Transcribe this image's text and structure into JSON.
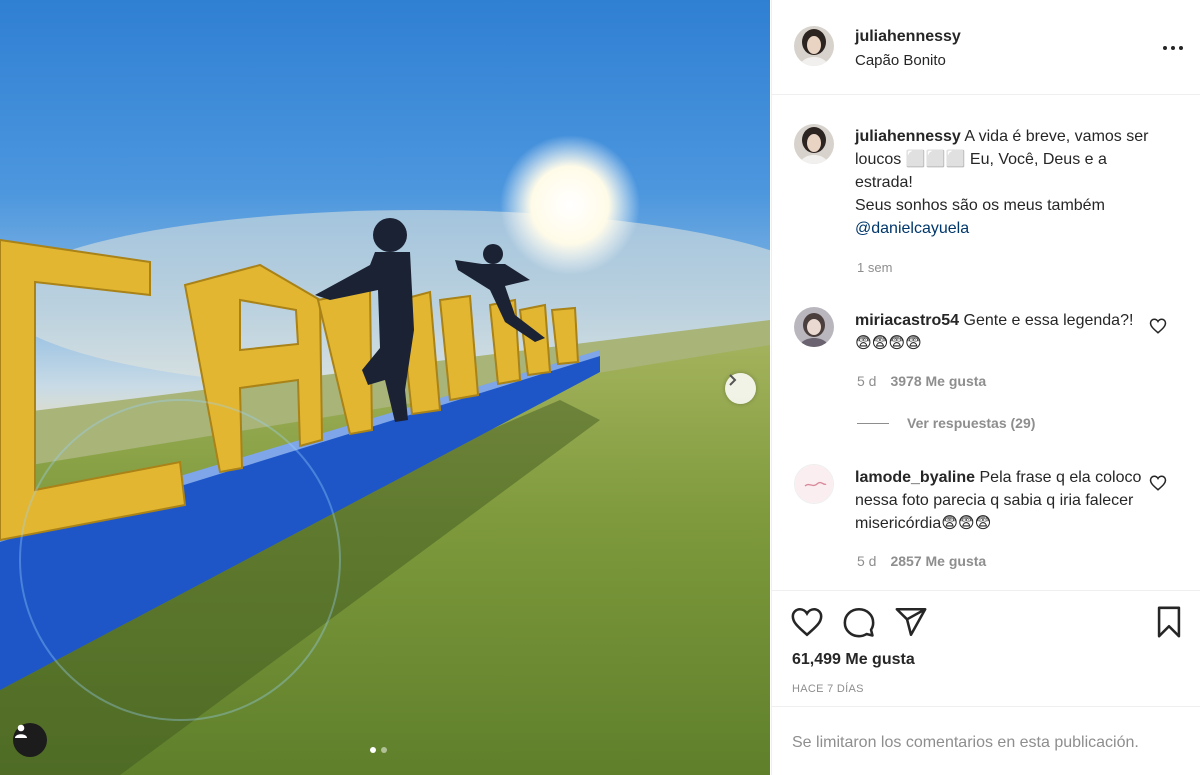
{
  "post": {
    "username": "juliahennessy",
    "location": "Capão Bonito",
    "caption": {
      "username": "juliahennessy",
      "line1": " A vida é breve, vamos ser loucos ⬜⬜⬜ Eu, Você, Deus e a estrada!",
      "line2": "Seus sonhos são os meus também",
      "mention": "@danielcayuela",
      "age": "1 sem"
    },
    "likes": "61,499 Me gusta",
    "posted": "HACE 7 DÍAS",
    "comments_limited": "Se limitaron los comentarios en esta publicación."
  },
  "comments": [
    {
      "username": "miriacastro54",
      "text": " Gente e essa legenda?!😨😨😨😨",
      "age": "5 d",
      "likes": "3978 Me gusta",
      "replies": "Ver respuestas (29)"
    },
    {
      "username": "lamode_byaline",
      "text": " Pela frase q ela coloco nessa foto parecia q sabia q iria falecer misericórdia😨😨😨",
      "age": "5 d",
      "likes": "2857 Me gusta"
    }
  ],
  "icons": {
    "more": "more-options-icon",
    "like": "heart-icon",
    "comment": "comment-icon",
    "share": "share-icon",
    "save": "bookmark-icon",
    "next": "chevron-right-icon",
    "tag": "user-tag-icon"
  },
  "colors": {
    "link": "#00376b",
    "secondary_text": "#8e8e8e",
    "sign_yellow": "#e8b92e",
    "sign_blue": "#1e56c8"
  }
}
